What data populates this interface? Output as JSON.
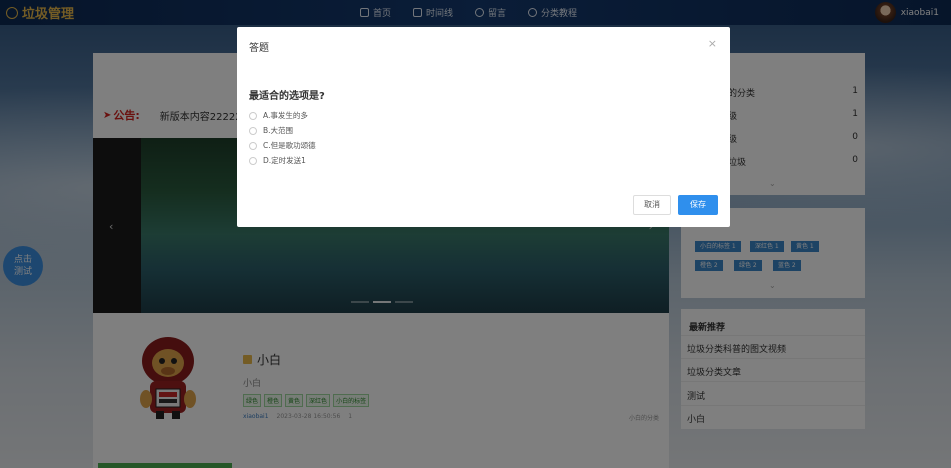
{
  "nav": {
    "logo_text": "垃圾管理",
    "items": [
      {
        "label": "首页",
        "icon": "home-icon"
      },
      {
        "label": "时间线",
        "icon": "pen-icon"
      },
      {
        "label": "留言",
        "icon": "message-icon"
      },
      {
        "label": "分类教程",
        "icon": "chat-icon"
      }
    ],
    "user_name": "xiaobai1"
  },
  "notice": {
    "label": "公告:",
    "text": "新版本内容2222222"
  },
  "post": {
    "title": "小白",
    "subtitle": "小白",
    "tags": [
      "绿色",
      "橙色",
      "黄色",
      "深红色",
      "小白的标签"
    ],
    "author": "xiaobai1",
    "date": "2023-03-28 16:50:56",
    "views": "1",
    "category": "小白的分类"
  },
  "categories": [
    {
      "name": "的分类",
      "count": "1"
    },
    {
      "name": "级",
      "count": "1"
    },
    {
      "name": "级",
      "count": "0"
    },
    {
      "name": "垃圾",
      "count": "0"
    }
  ],
  "tags_panel": [
    "小白的标签 1",
    "深红色 1",
    "黄色 1",
    "橙色 2",
    "绿色 2",
    "蓝色 2"
  ],
  "recommend": {
    "heading": "最新推荐",
    "items": [
      "垃圾分类科普的图文视频",
      "垃圾分类文章",
      "测试",
      "小白"
    ]
  },
  "float_button": {
    "line1": "点击",
    "line2": "测试"
  },
  "modal": {
    "title": "答题",
    "close": "×",
    "question": "最适合的选项是?",
    "options": [
      "A.事发生的多",
      "B.大范围",
      "C.但是歌功颂德",
      "D.定时发送1"
    ],
    "cancel": "取消",
    "save": "保存"
  }
}
